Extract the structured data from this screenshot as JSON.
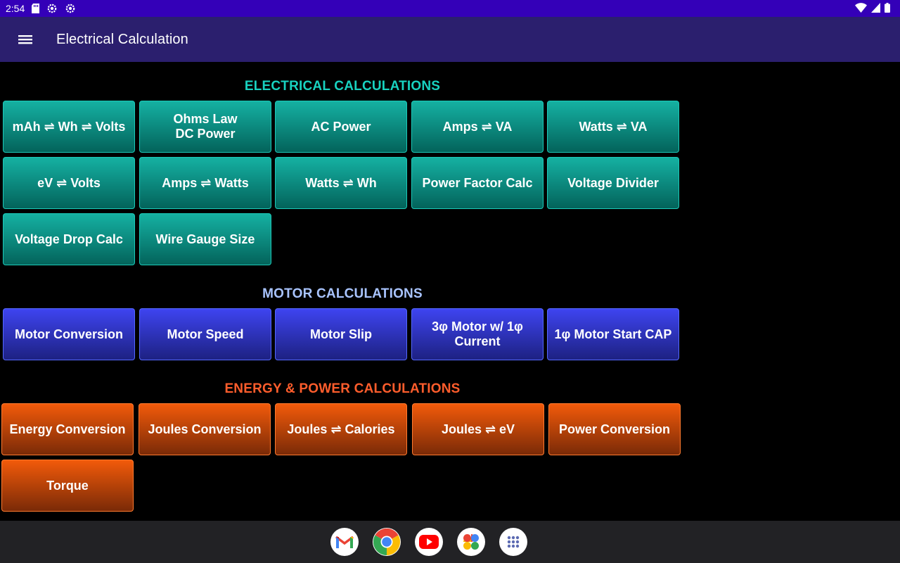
{
  "status_bar": {
    "time": "2:54"
  },
  "app_bar": {
    "title": "Electrical Calculation"
  },
  "sections": {
    "electrical": {
      "title": "ELECTRICAL CALCULATIONS",
      "items": [
        "mAh ⇌ Wh ⇌ Volts",
        "Ohms Law\nDC Power",
        "AC Power",
        "Amps ⇌ VA",
        "Watts ⇌ VA",
        "eV ⇌ Volts",
        "Amps ⇌ Watts",
        "Watts ⇌ Wh",
        "Power Factor Calc",
        "Voltage Divider",
        "Voltage Drop Calc",
        "Wire Gauge Size"
      ]
    },
    "motor": {
      "title": "MOTOR CALCULATIONS",
      "items": [
        "Motor Conversion",
        "Motor Speed",
        "Motor Slip",
        "3φ Motor w/ 1φ\nCurrent",
        "1φ Motor Start CAP"
      ]
    },
    "energy": {
      "title": "ENERGY & POWER CALCULATIONS",
      "items": [
        "Energy Conversion",
        "Joules Conversion",
        "Joules ⇌ Calories",
        "Joules ⇌ eV",
        "Power Conversion",
        "Torque"
      ]
    }
  },
  "colors": {
    "status_bar": "#3400b8",
    "app_bar": "#2b1f6e",
    "electrical_title": "#18d2c0",
    "motor_title": "#a9c4ff",
    "energy_title": "#ff5d2c"
  },
  "dock": [
    "gmail-icon",
    "chrome-icon",
    "youtube-icon",
    "photos-icon",
    "app-drawer-icon"
  ]
}
